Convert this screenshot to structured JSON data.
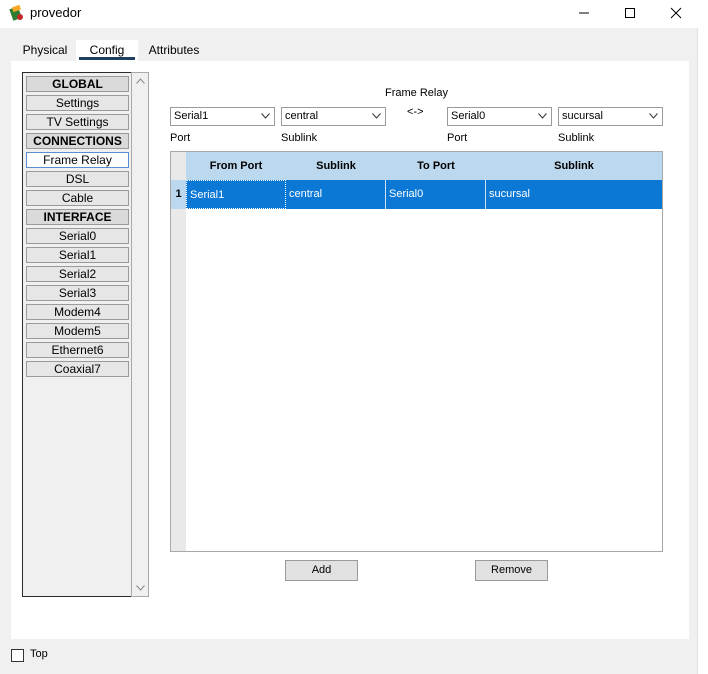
{
  "window": {
    "title": "provedor",
    "icon": "packet-tracer-router-icon",
    "controls": [
      "minimize-icon",
      "maximize-icon",
      "close-icon"
    ]
  },
  "tabs": [
    {
      "label": "Physical",
      "active": false
    },
    {
      "label": "Config",
      "active": true
    },
    {
      "label": "Attributes",
      "active": false
    }
  ],
  "sidebar": {
    "items": [
      {
        "label": "GLOBAL",
        "header": true
      },
      {
        "label": "Settings"
      },
      {
        "label": "TV Settings"
      },
      {
        "label": "CONNECTIONS",
        "header": true
      },
      {
        "label": "Frame Relay",
        "selected": true
      },
      {
        "label": "DSL"
      },
      {
        "label": "Cable"
      },
      {
        "label": "INTERFACE",
        "header": true
      },
      {
        "label": "Serial0"
      },
      {
        "label": "Serial1"
      },
      {
        "label": "Serial2"
      },
      {
        "label": "Serial3"
      },
      {
        "label": "Modem4"
      },
      {
        "label": "Modem5"
      },
      {
        "label": "Ethernet6"
      },
      {
        "label": "Coaxial7"
      }
    ]
  },
  "frame_relay": {
    "title": "Frame Relay",
    "link_symbol": "<->",
    "from_port": {
      "value": "Serial1",
      "label": "Port"
    },
    "from_sublink": {
      "value": "central",
      "label": "Sublink"
    },
    "to_port": {
      "value": "Serial0",
      "label": "Port"
    },
    "to_sublink": {
      "value": "sucursal",
      "label": "Sublink"
    },
    "table": {
      "columns": [
        "From Port",
        "Sublink",
        "To Port",
        "Sublink"
      ],
      "rows": [
        {
          "num": "1",
          "from_port": "Serial1",
          "from_sublink": "central",
          "to_port": "Serial0",
          "to_sublink": "sucursal"
        }
      ]
    },
    "add_label": "Add",
    "remove_label": "Remove"
  },
  "footer": {
    "top_label": "Top",
    "top_checked": false
  },
  "colors": {
    "selection": "#0b78d6",
    "header": "#bcd8ee",
    "tab_underline": "#1f3f5f"
  }
}
